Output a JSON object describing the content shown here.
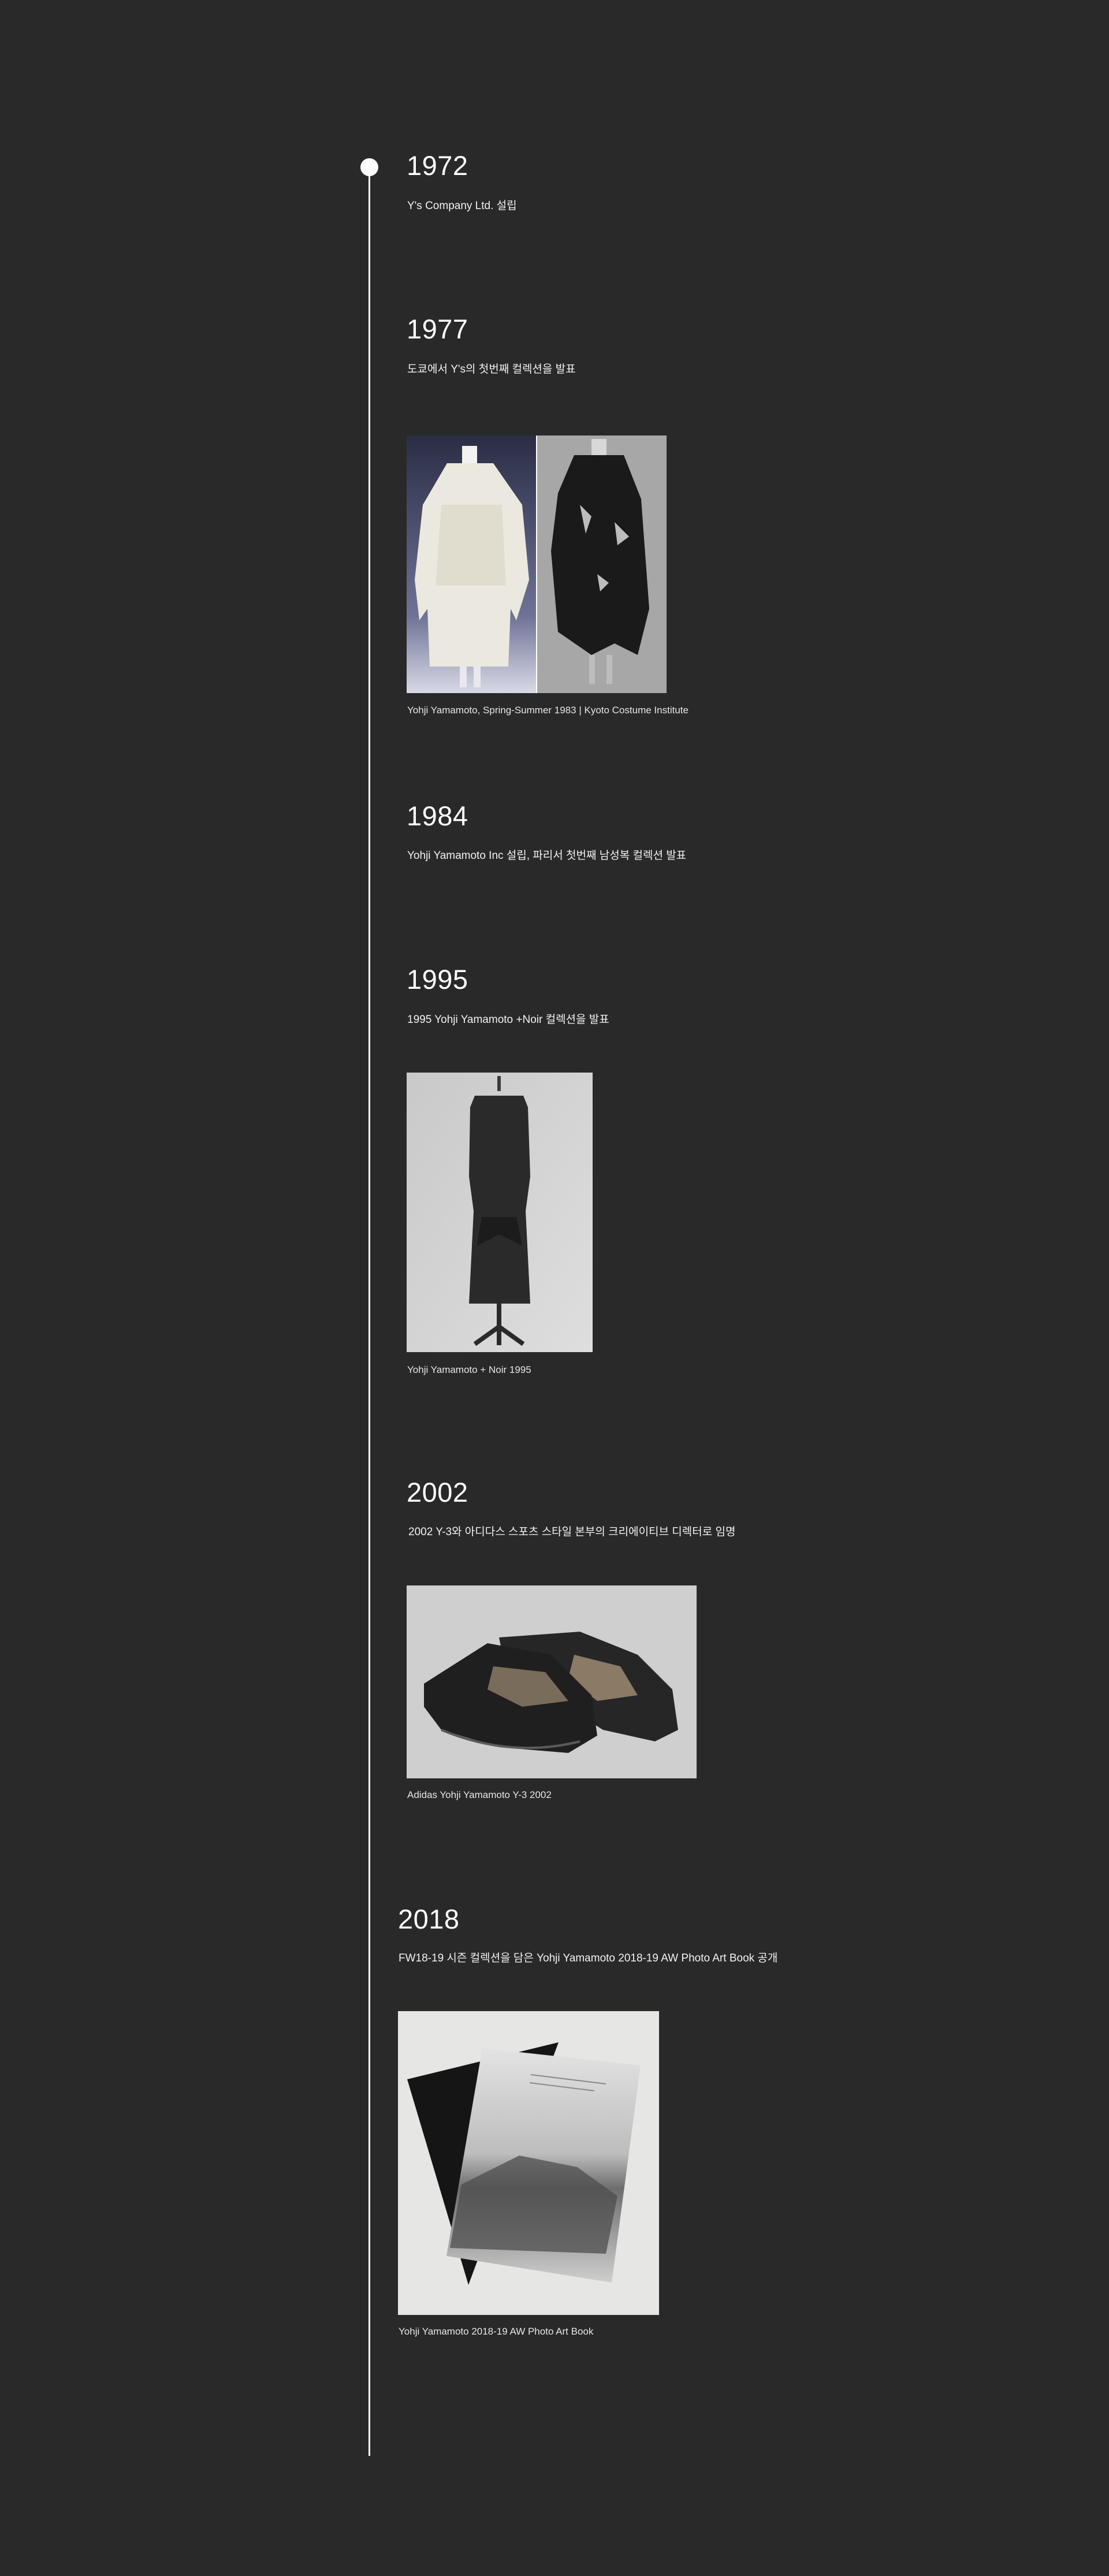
{
  "timeline": {
    "entries": [
      {
        "year": "1972",
        "description": "Y's Company Ltd. 설립"
      },
      {
        "year": "1977",
        "description": "도쿄에서 Y's의 첫번째 컬렉션을 발표",
        "image": {
          "icon": "garment-photo-icon",
          "caption": "Yohji Yamamoto, Spring-Summer 1983 | Kyoto Costume Institute"
        }
      },
      {
        "year": "1984",
        "description": "Yohji Yamamoto Inc 설립, 파리서 첫번째 남성복 컬렉션 발표"
      },
      {
        "year": "1995",
        "description": "1995 Yohji Yamamoto +Noir 컬렉션을 발표",
        "image": {
          "icon": "dress-photo-icon",
          "caption": "Yohji Yamamoto + Noir 1995"
        }
      },
      {
        "year": "2002",
        "description": "2002 Y-3와 아디다스 스포츠 스타일 본부의 크리에이티브 디렉터로 임명",
        "image": {
          "icon": "shoes-photo-icon",
          "caption": "Adidas Yohji Yamamoto Y-3 2002"
        }
      },
      {
        "year": "2018",
        "description": "FW18-19 시즌 컬렉션을 담은 Yohji Yamamoto 2018-19 AW Photo Art Book 공개",
        "image": {
          "icon": "photo-book-icon",
          "caption": "Yohji Yamamoto 2018-19 AW Photo Art Book"
        }
      }
    ]
  },
  "colors": {
    "background": "#292929",
    "line": "#ffffff",
    "text": "#ffffff"
  }
}
